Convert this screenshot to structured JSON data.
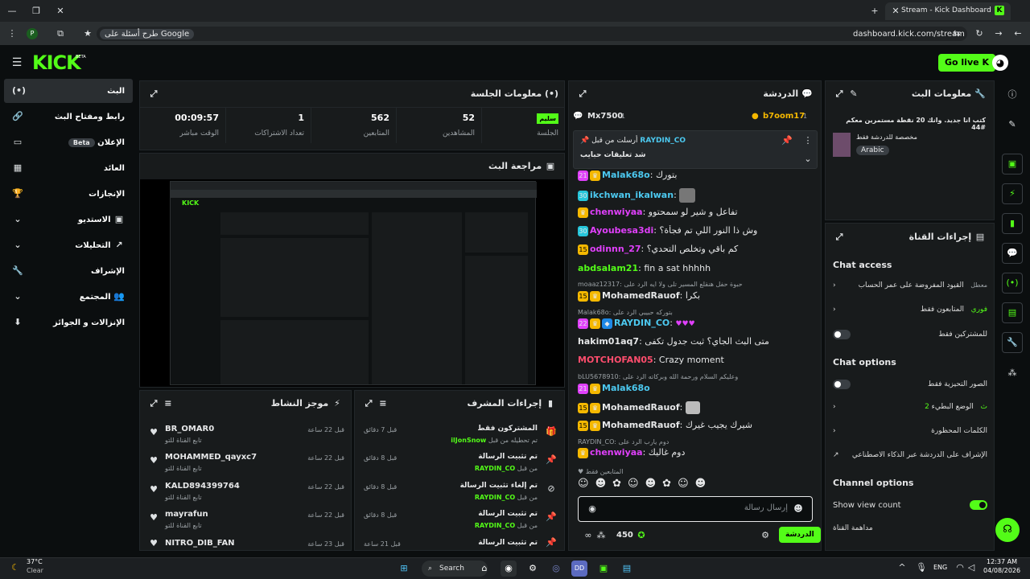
{
  "browser": {
    "tab_title": "Stream - Kick Dashboard",
    "url": "dashboard.kick.com/stream",
    "search_hint": "طرح أسئلة على Google",
    "profile_badge": "P"
  },
  "topnav": {
    "logo": "KICK",
    "logo_sup": "BETA",
    "go_live": "Go live"
  },
  "sidebar": {
    "items": [
      {
        "label": "البث",
        "icon": "stream-icon"
      },
      {
        "label": "رابط ومفتاح البث",
        "icon": "link-icon"
      },
      {
        "label": "الإعلان",
        "icon": "ad-icon",
        "badge": "Beta"
      },
      {
        "label": "العائد",
        "icon": "revenue-icon"
      },
      {
        "label": "الإنجازات",
        "icon": "trophy-icon"
      },
      {
        "label": "الاستديو",
        "icon": "studio-icon"
      },
      {
        "label": "التحليلات",
        "icon": "analytics-icon"
      },
      {
        "label": "الإشراف",
        "icon": "wrench-icon"
      },
      {
        "label": "المجتمع",
        "icon": "community-icon"
      },
      {
        "label": "الإنزالات و الجوائز",
        "icon": "drops-icon"
      }
    ]
  },
  "session": {
    "title": "معلومات الجلسة",
    "status": "سليم",
    "status_label": "الجلسة",
    "stats": [
      {
        "value": "52",
        "label": "المشاهدين"
      },
      {
        "value": "562",
        "label": "المتابعين"
      },
      {
        "value": "1",
        "label": "تعداد الاشتراكات"
      },
      {
        "value": "00:09:57",
        "label": "الوقت مباشر"
      }
    ]
  },
  "preview": {
    "title": "مراجعة البث"
  },
  "activity": {
    "title": "موجز النشاط",
    "items": [
      {
        "name": "BR_OMAR0",
        "sub": "تابع القناة للتو",
        "time": "قبل 22 ساعة"
      },
      {
        "name": "MOHAMMED_qayxc7",
        "sub": "تابع القناة للتو",
        "time": "قبل 22 ساعة"
      },
      {
        "name": "KALD894399764",
        "sub": "تابع القناة للتو",
        "time": "قبل 22 ساعة"
      },
      {
        "name": "mayrafun",
        "sub": "تابع القناة للتو",
        "time": "قبل 22 ساعة"
      },
      {
        "name": "NITRO_DIB_FAN",
        "sub": "",
        "time": "قبل 23 ساعة"
      }
    ]
  },
  "modactions": {
    "title": "إجراءات المشرف",
    "items": [
      {
        "title": "المشتركون فقط",
        "sub": "تم تحطيله من قبل",
        "user": "ilJonSnow",
        "time": "قبل 7 دقائق",
        "icon": "gift-icon"
      },
      {
        "title": "تم تثبيت الرسالة",
        "sub": "من قبل",
        "user": "RAYDIN_CO",
        "time": "قبل 8 دقائق",
        "icon": "pin-icon"
      },
      {
        "title": "تم إلغاء تثبيت الرسالة",
        "sub": "من قبل",
        "user": "RAYDIN_CO",
        "time": "قبل 8 دقائق",
        "icon": "unpin-icon"
      },
      {
        "title": "تم تثبيت الرسالة",
        "sub": "من قبل",
        "user": "RAYDIN_CO",
        "time": "قبل 8 دقائق",
        "icon": "pin-icon"
      },
      {
        "title": "تم تثبيت الرسالة",
        "sub": "",
        "user": "",
        "time": "قبل 21 ساعة",
        "icon": "pin-icon"
      }
    ]
  },
  "chat": {
    "title": "الدردشة",
    "top_left": "Mx7500",
    "top_left_count": "1",
    "top_right": "b7oom17",
    "top_right_count": "1",
    "pinned_by_label": "أرسلت من قبل",
    "pinned_user": "RAYDIN_CO",
    "pinned_text": "شد تعليقات حبايب",
    "messages": [
      {
        "user": "Malak68o",
        "color": "#4cc9f0",
        "text": "بتورك",
        "badge": "21"
      },
      {
        "user": "ikchwan_ikalwan",
        "color": "#4cc9f0",
        "text": "",
        "badge": "30"
      },
      {
        "user": "chenwiyaa",
        "color": "#e040fb",
        "text": "تفاعل و شير لو سمحتوو",
        "badge": ""
      },
      {
        "user": "Ayoubesa3di",
        "color": "#e040fb",
        "text": "وش ذا النور اللي تم فجأة؟",
        "badge": "30"
      },
      {
        "user": "odinnn_27",
        "color": "#e040fb",
        "text": "كم باقي وتخلص التحدي؟",
        "badge": "15"
      },
      {
        "user": "abdsalam21",
        "color": "#53fc18",
        "text": "fin a sat hhhhh",
        "badge": ""
      },
      {
        "user": "MohamedRauof",
        "color": "#ffffff",
        "text": "بكرا",
        "badge": "15",
        "reply": "moaaz12317: حبوة حفل هنقلع المسير تلى ولا ايه الرد على"
      },
      {
        "user": "RAYDIN_CO",
        "color": "#4cc9f0",
        "text": "",
        "badge": "22",
        "reply": "Malak68o: بتوركه حبيبي الرد على"
      },
      {
        "user": "hakim01aq7",
        "color": "#ffffff",
        "text": "متى البث الجاي؟ ثبت جدول تكفى",
        "badge": ""
      },
      {
        "user": "MOTCHOFAN05",
        "color": "#ff4d6d",
        "text": "Crazy moment",
        "badge": ""
      },
      {
        "user": "Malak68o",
        "color": "#4cc9f0",
        "text": "",
        "badge": "21",
        "reply": "bLU5678910: وعليكم السلام ورحمة الله وبركاته الرد على"
      },
      {
        "user": "MohamedRauof",
        "color": "#ffffff",
        "text": "",
        "badge": "15"
      },
      {
        "user": "MohamedRauof",
        "color": "#ffffff",
        "text": "شيرك يجيب غيرك",
        "badge": "15"
      },
      {
        "user": "chenwiyaa",
        "color": "#e040fb",
        "text": "دوم غاليك",
        "badge": "",
        "reply": "RAYDIN_CO: دوم يارب الرد على"
      }
    ],
    "followers_only": "المتابعين فقط",
    "input_placeholder": "إرسال رسالة",
    "points": "450",
    "send": "الدردشة"
  },
  "streaminfo": {
    "title": "معلومات البث",
    "stream_title": "كتب انا جديد. وانك 20 نقطة مستمرين معكم #44",
    "category": "مخصصة للدردشة فقط",
    "language": "Arabic"
  },
  "channelactions": {
    "title": "إجراءات القناة",
    "chat_access": "Chat access",
    "access_rows": [
      {
        "label": "القيود المفروضة على عمر الحساب",
        "value": "معطل"
      },
      {
        "label": "المتابعون فقط",
        "value": "فوري"
      },
      {
        "label": "للمشتركين فقط",
        "value": ""
      }
    ],
    "chat_options": "Chat options",
    "option_rows": [
      {
        "label": "الصور التحيزية فقط",
        "value": ""
      },
      {
        "label": "الوضع البطيء",
        "value": "2 ث"
      },
      {
        "label": "الكلمات المحظورة",
        "value": ""
      },
      {
        "label": "الإشراف على الدردشة عبر الذكاء الاصطناعي",
        "value": ""
      }
    ],
    "channel_options": "Channel options",
    "show_view_count": "Show view count",
    "channel_rows": [
      {
        "label": "مداهمة القناة"
      }
    ]
  },
  "taskbar": {
    "weather_temp": "37°C",
    "weather_desc": "Clear",
    "search": "Search",
    "lang": "ENG",
    "time": "12:37 AM",
    "date": "04/08/2026"
  }
}
